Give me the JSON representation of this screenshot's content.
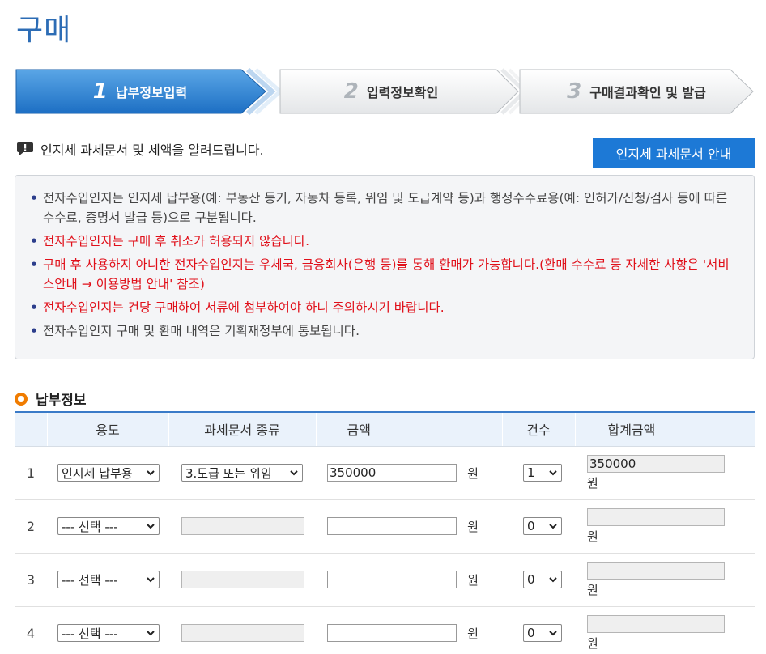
{
  "page": {
    "title": "구매"
  },
  "steps": [
    {
      "num": "1",
      "label": "납부정보입력",
      "state": "active"
    },
    {
      "num": "2",
      "label": "입력정보확인",
      "state": "inactive"
    },
    {
      "num": "3",
      "label": "구매결과확인 및 발급",
      "state": "inactive"
    }
  ],
  "notice": {
    "heading": "인지세 과세문서 및 세액을 알려드립니다.",
    "guide_button": "인지세 과세문서 안내",
    "items": [
      {
        "text": "전자수입인지는 인지세 납부용(예: 부동산 등기, 자동차 등록, 위임 및 도급계약 등)과 행정수수료용(예: 인허가/신청/검사 등에 따른 수수료, 증명서 발급 등)으로 구분됩니다.",
        "highlight": false
      },
      {
        "text": "전자수입인지는 구매 후 취소가 허용되지 않습니다.",
        "highlight": true
      },
      {
        "text": "구매 후 사용하지 아니한 전자수입인지는 우체국, 금융회사(은행 등)를 통해 환매가 가능합니다.(환매 수수료 등 자세한 사항은 '서비스안내 → 이용방법 안내' 참조)",
        "highlight": true
      },
      {
        "text": "전자수입인지는 건당 구매하여 서류에 첨부하여야 하니 주의하시기 바랍니다.",
        "highlight": true
      },
      {
        "text": "전자수입인지 구매 및 환매 내역은 기획재정부에 통보됩니다.",
        "highlight": false
      }
    ]
  },
  "section": {
    "title": "납부정보"
  },
  "table": {
    "headers": [
      "",
      "용도",
      "과세문서 종류",
      "금액",
      "건수",
      "합계금액"
    ],
    "currency": "원",
    "rows": [
      {
        "num": "1",
        "purpose": "인지세 납부용",
        "doc_type": "3.도급 또는 위임",
        "amount": "350000",
        "count": "1",
        "total": "350000"
      },
      {
        "num": "2",
        "purpose": "--- 선택 ---",
        "doc_type": "",
        "amount": "",
        "count": "0",
        "total": ""
      },
      {
        "num": "3",
        "purpose": "--- 선택 ---",
        "doc_type": "",
        "amount": "",
        "count": "0",
        "total": ""
      },
      {
        "num": "4",
        "purpose": "--- 선택 ---",
        "doc_type": "",
        "amount": "",
        "count": "0",
        "total": ""
      }
    ]
  },
  "colors": {
    "accent": "#1d79d6",
    "title": "#2c6cb5",
    "warning": "#e0101a",
    "bullet": "#f07c00"
  }
}
